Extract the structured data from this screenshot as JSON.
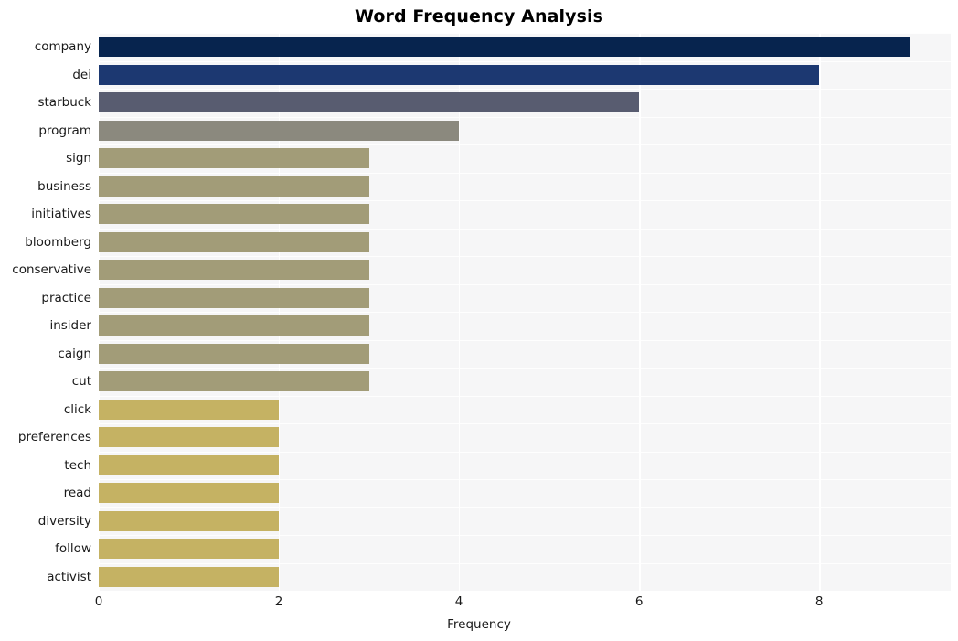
{
  "chart_data": {
    "type": "bar",
    "orientation": "horizontal",
    "title": "Word Frequency Analysis",
    "xlabel": "Frequency",
    "ylabel": "",
    "categories": [
      "company",
      "dei",
      "starbuck",
      "program",
      "sign",
      "business",
      "initiatives",
      "bloomberg",
      "conservative",
      "practice",
      "insider",
      "caign",
      "cut",
      "click",
      "preferences",
      "tech",
      "read",
      "diversity",
      "follow",
      "activist"
    ],
    "values": [
      9,
      8,
      6,
      4,
      3,
      3,
      3,
      3,
      3,
      3,
      3,
      3,
      3,
      2,
      2,
      2,
      2,
      2,
      2,
      2
    ],
    "bar_colors": [
      "#07244e",
      "#1c3871",
      "#585c70",
      "#8b897e",
      "#a29c78",
      "#a29c78",
      "#a29c78",
      "#a29c78",
      "#a29c78",
      "#a29c78",
      "#a29c78",
      "#a29c78",
      "#a29c78",
      "#c5b263",
      "#c5b263",
      "#c5b263",
      "#c5b263",
      "#c5b263",
      "#c5b263",
      "#c5b263"
    ],
    "xlim": [
      0,
      9.46
    ],
    "xticks": [
      0,
      2,
      4,
      6,
      8
    ],
    "xtick_labels": [
      "0",
      "2",
      "4",
      "6",
      "8"
    ],
    "grid": true,
    "grid_axis": "both",
    "grid_color": "#ffffff",
    "plot_background": "#f6f6f7",
    "figure_background": "#ffffff",
    "legend": null
  }
}
